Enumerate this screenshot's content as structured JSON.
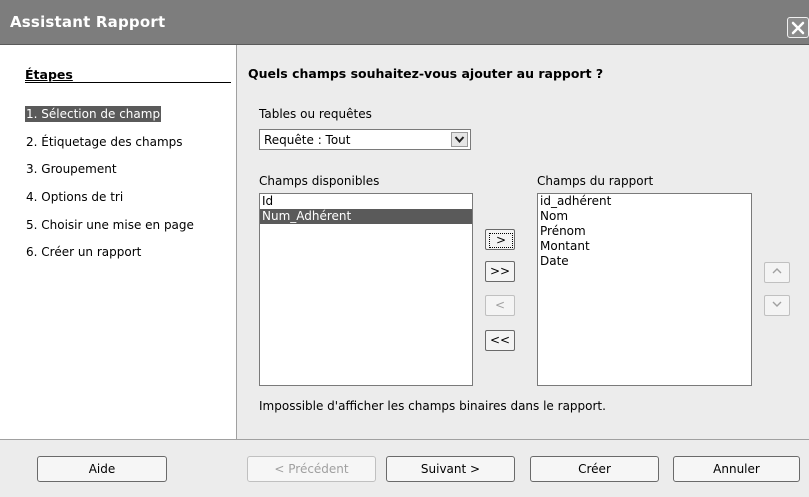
{
  "window": {
    "title": "Assistant Rapport"
  },
  "steps": {
    "heading": "Étapes",
    "items": [
      {
        "label": "1. Sélection de champ",
        "selected": true
      },
      {
        "label": "2. Étiquetage des champs",
        "selected": false
      },
      {
        "label": "3. Groupement",
        "selected": false
      },
      {
        "label": "4. Options de tri",
        "selected": false
      },
      {
        "label": "5. Choisir une mise en page",
        "selected": false
      },
      {
        "label": "6. Créer un rapport",
        "selected": false
      }
    ]
  },
  "main": {
    "question": "Quels champs souhaitez-vous ajouter au rapport ?",
    "tables_label": "Tables ou requêtes",
    "tables_value": "Requête : Tout",
    "available_label": "Champs disponibles",
    "available_fields": [
      "Id",
      "Num_Adhérent"
    ],
    "available_selected": "Num_Adhérent",
    "report_label": "Champs du rapport",
    "report_fields": [
      "id_adhérent",
      "Nom",
      "Prénom",
      "Montant",
      "Date"
    ],
    "move_buttons": {
      "add_one": ">",
      "add_all": ">>",
      "remove_one": "<",
      "remove_all": "<<"
    },
    "order_buttons": {
      "up": "^",
      "down": "v"
    },
    "note": "Impossible d'afficher les champs binaires dans le rapport."
  },
  "footer": {
    "help": "Aide",
    "previous": "< Précédent",
    "next": "Suivant >",
    "create": "Créer",
    "cancel": "Annuler"
  }
}
